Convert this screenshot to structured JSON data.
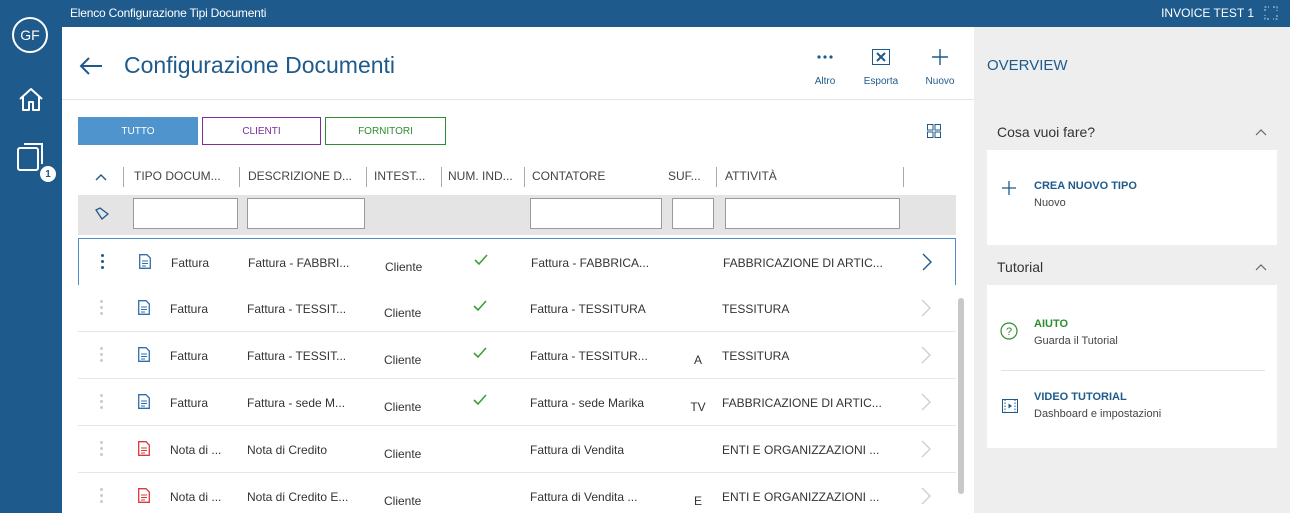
{
  "rail": {
    "avatar": "GF",
    "badge": "1"
  },
  "topbar": {
    "title": "Elenco Configurazione Tipi Documenti",
    "company": "INVOICE TEST 1"
  },
  "header": {
    "title": "Configurazione Documenti",
    "actions": [
      {
        "label": "Altro",
        "icon": "more-dots-icon"
      },
      {
        "label": "Esporta",
        "icon": "excel-icon"
      },
      {
        "label": "Nuovo",
        "icon": "plus-icon"
      }
    ]
  },
  "filters": {
    "tutto": "TUTTO",
    "clienti": "CLIENTI",
    "fornitori": "FORNITORI"
  },
  "table": {
    "columns": [
      "TIPO DOCUM...",
      "DESCRIZIONE D...",
      "INTEST...",
      "NUM. IND...",
      "CONTATORE",
      "SUF...",
      "ATTIVITÀ"
    ],
    "rows": [
      {
        "tipo": "Fattura",
        "descrizione": "Fattura - FABBRI...",
        "intestatario": "Cliente",
        "num_ind": true,
        "contatore": "Fattura - FABBRICA...",
        "suffisso": "",
        "attivita": "FABBRICAZIONE DI ARTIC...",
        "doc_color": "#2f6fad",
        "selected": true
      },
      {
        "tipo": "Fattura",
        "descrizione": "Fattura - TESSIT...",
        "intestatario": "Cliente",
        "num_ind": true,
        "contatore": "Fattura - TESSITURA",
        "suffisso": "",
        "attivita": "TESSITURA",
        "doc_color": "#2f6fad",
        "selected": false
      },
      {
        "tipo": "Fattura",
        "descrizione": "Fattura - TESSIT...",
        "intestatario": "Cliente",
        "num_ind": true,
        "contatore": "Fattura - TESSITUR...",
        "suffisso": "A",
        "attivita": "TESSITURA",
        "doc_color": "#2f6fad",
        "selected": false
      },
      {
        "tipo": "Fattura",
        "descrizione": "Fattura - sede M...",
        "intestatario": "Cliente",
        "num_ind": true,
        "contatore": "Fattura - sede Marika",
        "suffisso": "TV",
        "attivita": "FABBRICAZIONE DI ARTIC...",
        "doc_color": "#2f6fad",
        "selected": false
      },
      {
        "tipo": "Nota di ...",
        "descrizione": "Nota di Credito",
        "intestatario": "Cliente",
        "num_ind": false,
        "contatore": "Fattura di Vendita",
        "suffisso": "",
        "attivita": "ENTI E ORGANIZZAZIONI ...",
        "doc_color": "#d93a3a",
        "selected": false
      },
      {
        "tipo": "Nota di ...",
        "descrizione": "Nota di Credito E...",
        "intestatario": "Cliente",
        "num_ind": false,
        "contatore": "Fattura di Vendita ...",
        "suffisso": "E",
        "attivita": "ENTI E ORGANIZZAZIONI ...",
        "doc_color": "#d93a3a",
        "selected": false
      }
    ]
  },
  "overview": {
    "title": "OVERVIEW",
    "cosa": {
      "title": "Cosa vuoi fare?",
      "item_title": "CREA NUOVO TIPO",
      "item_sub": "Nuovo"
    },
    "tutorial": {
      "title": "Tutorial",
      "aiuto_title": "AIUTO",
      "aiuto_sub": "Guarda il Tutorial",
      "video_title": "VIDEO TUTORIAL",
      "video_sub": "Dashboard e impostazioni"
    }
  },
  "colors": {
    "brand": "#1e5a8c",
    "accent": "#4f94cd",
    "clienti": "#7b2e9a",
    "fornitori": "#2f8c2f",
    "check": "#3aa03a"
  }
}
